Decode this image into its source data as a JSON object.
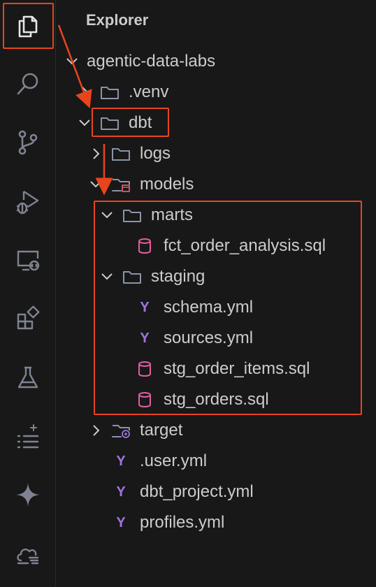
{
  "explorer": {
    "title": "Explorer",
    "tree": [
      {
        "label": "agentic-data-labs",
        "type": "folder-open",
        "level": 0
      },
      {
        "label": ".venv",
        "type": "folder-closed",
        "level": 1
      },
      {
        "label": "dbt",
        "type": "folder-open",
        "level": 1
      },
      {
        "label": "logs",
        "type": "folder-closed",
        "level": 2
      },
      {
        "label": "models",
        "type": "folder-open-special",
        "level": 2
      },
      {
        "label": "marts",
        "type": "folder-open",
        "level": 3
      },
      {
        "label": "fct_order_analysis.sql",
        "type": "sql-file",
        "level": 4
      },
      {
        "label": "staging",
        "type": "folder-open",
        "level": 3
      },
      {
        "label": "schema.yml",
        "type": "yml-file",
        "level": 4
      },
      {
        "label": "sources.yml",
        "type": "yml-file",
        "level": 4
      },
      {
        "label": "stg_order_items.sql",
        "type": "sql-file",
        "level": 4
      },
      {
        "label": "stg_orders.sql",
        "type": "sql-file",
        "level": 4
      },
      {
        "label": "target",
        "type": "folder-closed-special",
        "level": 2
      },
      {
        "label": ".user.yml",
        "type": "yml-file",
        "level": 2
      },
      {
        "label": "dbt_project.yml",
        "type": "yml-file",
        "level": 2
      },
      {
        "label": "profiles.yml",
        "type": "yml-file",
        "level": 2
      }
    ]
  },
  "activity_bar": {
    "icons": [
      "files-icon",
      "search-icon",
      "source-control-icon",
      "run-debug-icon",
      "remote-explorer-icon",
      "extensions-icon",
      "testing-icon",
      "timeline-icon",
      "sparkle-icon",
      "cloud-icon"
    ]
  },
  "colors": {
    "background": "#181818",
    "text": "#cccccc",
    "annotation": "#e8451f",
    "folder_icon": "#8a94a8",
    "sql_icon": "#e0609e",
    "yml_icon": "#a074e0"
  }
}
